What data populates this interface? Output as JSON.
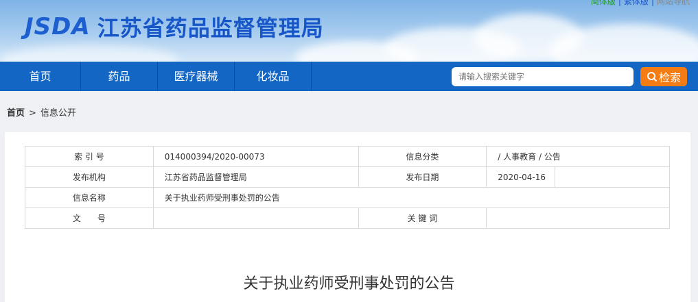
{
  "header": {
    "logo_en": "JSDA",
    "logo_cn": "江苏省药品监督管理局",
    "top_links": [
      "简体版",
      "繁体版",
      "网站导航"
    ]
  },
  "nav": {
    "items": [
      "首页",
      "药品",
      "医疗器械",
      "化妆品"
    ],
    "search_placeholder": "请输入搜索关键字",
    "search_button": "检索"
  },
  "breadcrumb": {
    "home": "首页",
    "separator": ">",
    "current": "信息公开"
  },
  "meta_table": {
    "index_label": "索 引 号",
    "index_value": "014000394/2020-00073",
    "category_label": "信息分类",
    "category_value": "/ 人事教育 / 公告",
    "publisher_label": "发布机构",
    "publisher_value": "江苏省药品监督管理局",
    "date_label": "发布日期",
    "date_value": "2020-04-16",
    "name_label": "信息名称",
    "name_value": "关于执业药师受刑事处罚的公告",
    "docno_label": "文　　号",
    "docno_value": "",
    "keywords_label": "关 键 词",
    "keywords_value": ""
  },
  "article": {
    "title": "关于执业药师受刑事处罚的公告"
  },
  "colors": {
    "nav": "#1366c3",
    "search_button": "#f47c12",
    "logo": "#1656c9"
  }
}
